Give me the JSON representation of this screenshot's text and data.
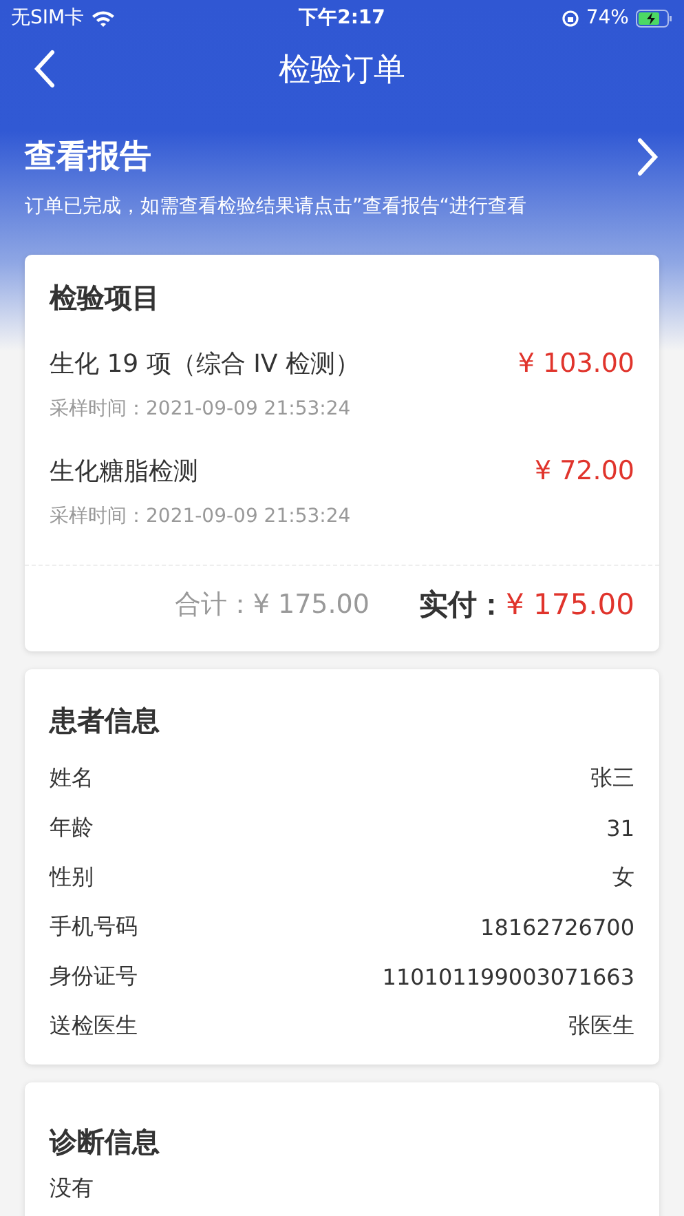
{
  "status_bar": {
    "carrier": "无SIM卡",
    "time": "下午2:17",
    "battery": "74%"
  },
  "nav": {
    "title": "检验订单"
  },
  "report": {
    "title": "查看报告",
    "note": "订单已完成，如需查看检验结果请点击”查看报告“进行查看"
  },
  "items_card": {
    "title": "检验项目",
    "items": [
      {
        "name": "生化 19 项（综合 IV 检测）",
        "price": "¥ 103.00",
        "time": "采样时间：2021-09-09 21:53:24"
      },
      {
        "name": "生化糖脂检测",
        "price": "¥ 72.00",
        "time": "采样时间：2021-09-09 21:53:24"
      }
    ],
    "total_label": "合计：",
    "total": "¥ 175.00",
    "paid_label": "实付：",
    "paid": "¥ 175.00"
  },
  "patient_card": {
    "title": "患者信息",
    "rows": [
      {
        "label": "姓名",
        "value": "张三"
      },
      {
        "label": "年龄",
        "value": "31"
      },
      {
        "label": "性别",
        "value": "女"
      },
      {
        "label": "手机号码",
        "value": "18162726700"
      },
      {
        "label": "身份证号",
        "value": "110101199003071663"
      },
      {
        "label": "送检医生",
        "value": "张医生"
      }
    ]
  },
  "diagnosis_card": {
    "title": "诊断信息",
    "text": "没有"
  }
}
